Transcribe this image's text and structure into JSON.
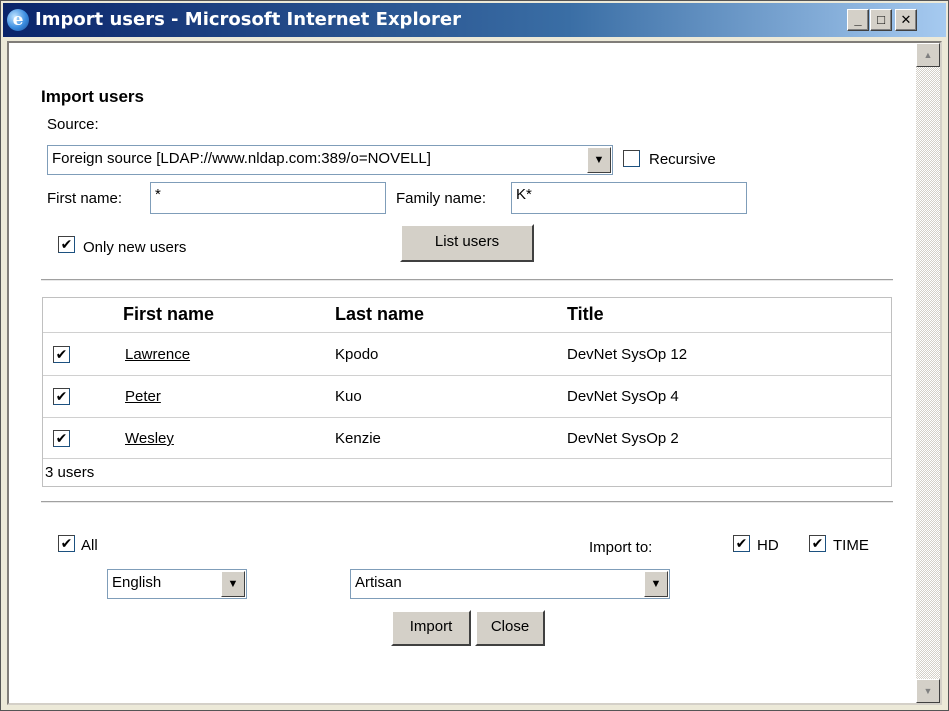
{
  "window": {
    "title": "Import users - Microsoft Internet Explorer",
    "controls": {
      "minimize": "_",
      "maximize": "□",
      "close": "✕"
    }
  },
  "form": {
    "heading": "Import users",
    "source_label": "Source:",
    "source_value": "Foreign source [LDAP://www.nldap.com:389/o=NOVELL]",
    "recursive_label": "Recursive",
    "recursive_checked": false,
    "first_name_label": "First name:",
    "first_name_value": "*",
    "family_name_label": "Family name:",
    "family_name_value": "K*",
    "only_new_label": "Only new users",
    "only_new_checked": true,
    "list_users_label": "List users"
  },
  "table": {
    "columns": [
      "First name",
      "Last name",
      "Title"
    ],
    "rows": [
      {
        "checked": true,
        "first": "Lawrence",
        "last": "Kpodo",
        "title": "DevNet SysOp 12"
      },
      {
        "checked": true,
        "first": "Peter",
        "last": "Kuo",
        "title": "DevNet SysOp 4"
      },
      {
        "checked": true,
        "first": "Wesley",
        "last": "Kenzie",
        "title": "DevNet SysOp 2"
      }
    ],
    "count_label": "3 users"
  },
  "bottom": {
    "all_label": "All",
    "all_checked": true,
    "import_to_label": "Import to:",
    "hd_label": "HD",
    "hd_checked": true,
    "time_label": "TIME",
    "time_checked": true,
    "language_value": "English",
    "role_value": "Artisan",
    "import_label": "Import",
    "close_label": "Close"
  },
  "icons": {
    "checkmark": "✔",
    "dropdown": "▼",
    "scroll_up": "▲",
    "scroll_down": "▼"
  }
}
